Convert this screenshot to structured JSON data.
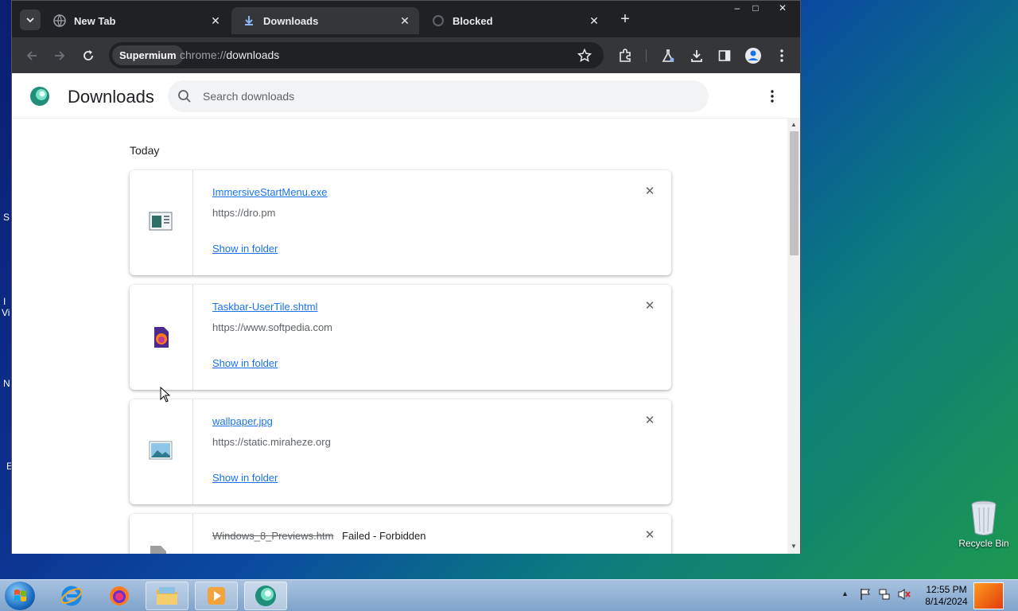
{
  "browser": {
    "tabs": [
      {
        "label": "New Tab"
      },
      {
        "label": "Downloads"
      },
      {
        "label": "Blocked"
      }
    ],
    "window_controls": {
      "minimize": "–",
      "maximize": "□",
      "close": "✕"
    },
    "omnibox": {
      "chip": "Supermium",
      "url_scheme": "chrome://",
      "url_host": "downloads"
    }
  },
  "page": {
    "title": "Downloads",
    "search_placeholder": "Search downloads",
    "day_label": "Today",
    "downloads": [
      {
        "filename": "ImmersiveStartMenu.exe",
        "source": "https://dro.pm",
        "action": "Show in folder",
        "icon": "exe-file-icon"
      },
      {
        "filename": "Taskbar-UserTile.shtml",
        "source": "https://www.softpedia.com",
        "action": "Show in folder",
        "icon": "firefox-html-icon"
      },
      {
        "filename": "wallpaper.jpg",
        "source": "https://static.miraheze.org",
        "action": "Show in folder",
        "icon": "image-file-icon"
      },
      {
        "filename": "Windows_8_Previews.htm",
        "status": "Failed - Forbidden",
        "icon": "generic-file-icon"
      }
    ]
  },
  "desktop": {
    "recycle_bin_label": "Recycle Bin",
    "edge_labels": [
      "S",
      "I",
      "Vi",
      "N",
      "E"
    ]
  },
  "taskbar": {
    "apps": [
      "internet-explorer",
      "firefox",
      "file-explorer",
      "media-player",
      "supermium"
    ],
    "clock_time": "12:55 PM",
    "clock_date": "8/14/2024"
  },
  "colors": {
    "link": "#1a73e8",
    "tab_bar": "#202124",
    "toolbar": "#35363a"
  }
}
